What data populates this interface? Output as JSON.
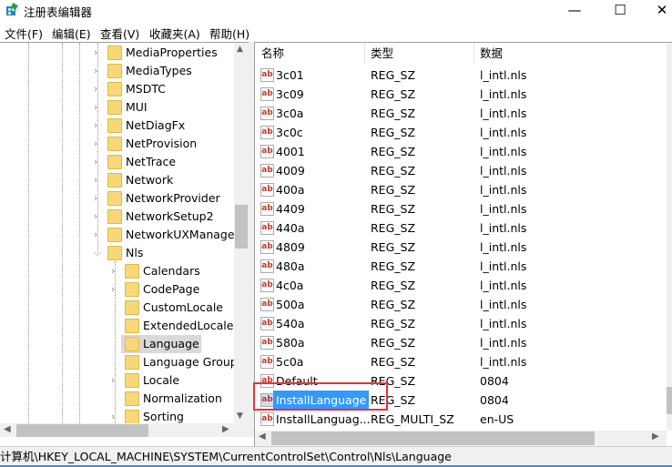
{
  "window": {
    "title": "注册表编辑器",
    "minimize": "—",
    "maximize": "☐",
    "close": "✕"
  },
  "menu": [
    "文件(F)",
    "编辑(E)",
    "查看(V)",
    "收藏夹(A)",
    "帮助(H)"
  ],
  "tree": {
    "level1": [
      {
        "label": "MediaProperties",
        "expandable": true
      },
      {
        "label": "MediaTypes",
        "expandable": true
      },
      {
        "label": "MSDTC",
        "expandable": true
      },
      {
        "label": "MUI",
        "expandable": true
      },
      {
        "label": "NetDiagFx",
        "expandable": true
      },
      {
        "label": "NetProvision",
        "expandable": true
      },
      {
        "label": "NetTrace",
        "expandable": true
      },
      {
        "label": "Network",
        "expandable": true
      },
      {
        "label": "NetworkProvider",
        "expandable": true
      },
      {
        "label": "NetworkSetup2",
        "expandable": true
      },
      {
        "label": "NetworkUXManager",
        "expandable": true
      },
      {
        "label": "Nls",
        "expandable": true,
        "expanded": true
      }
    ],
    "level2": [
      {
        "label": "Calendars",
        "expandable": true
      },
      {
        "label": "CodePage",
        "expandable": true
      },
      {
        "label": "CustomLocale",
        "expandable": false
      },
      {
        "label": "ExtendedLocale",
        "expandable": false
      },
      {
        "label": "Language",
        "expandable": false,
        "selected": true
      },
      {
        "label": "Language Group",
        "expandable": false
      },
      {
        "label": "Locale",
        "expandable": true
      },
      {
        "label": "Normalization",
        "expandable": false
      },
      {
        "label": "Sorting",
        "expandable": true
      }
    ]
  },
  "list": {
    "columns": [
      "名称",
      "类型",
      "数据"
    ],
    "rows": [
      [
        "3c01",
        "REG_SZ",
        "l_intl.nls"
      ],
      [
        "3c09",
        "REG_SZ",
        "l_intl.nls"
      ],
      [
        "3c0a",
        "REG_SZ",
        "l_intl.nls"
      ],
      [
        "3c0c",
        "REG_SZ",
        "l_intl.nls"
      ],
      [
        "4001",
        "REG_SZ",
        "l_intl.nls"
      ],
      [
        "4009",
        "REG_SZ",
        "l_intl.nls"
      ],
      [
        "400a",
        "REG_SZ",
        "l_intl.nls"
      ],
      [
        "4409",
        "REG_SZ",
        "l_intl.nls"
      ],
      [
        "440a",
        "REG_SZ",
        "l_intl.nls"
      ],
      [
        "4809",
        "REG_SZ",
        "l_intl.nls"
      ],
      [
        "480a",
        "REG_SZ",
        "l_intl.nls"
      ],
      [
        "4c0a",
        "REG_SZ",
        "l_intl.nls"
      ],
      [
        "500a",
        "REG_SZ",
        "l_intl.nls"
      ],
      [
        "540a",
        "REG_SZ",
        "l_intl.nls"
      ],
      [
        "580a",
        "REG_SZ",
        "l_intl.nls"
      ],
      [
        "5c0a",
        "REG_SZ",
        "l_intl.nls"
      ],
      [
        "Default",
        "REG_SZ",
        "0804"
      ],
      [
        "InstallLanguage",
        "REG_SZ",
        "0804"
      ],
      [
        "InstallLanguag...",
        "REG_MULTI_SZ",
        "en-US"
      ]
    ],
    "selected_index": 17,
    "icon": "ab"
  },
  "status": "计算机\\HKEY_LOCAL_MACHINE\\SYSTEM\\CurrentControlSet\\Control\\Nls\\Language",
  "colors": {
    "highlight": "#3399ff",
    "annotation": "#e8323c"
  }
}
